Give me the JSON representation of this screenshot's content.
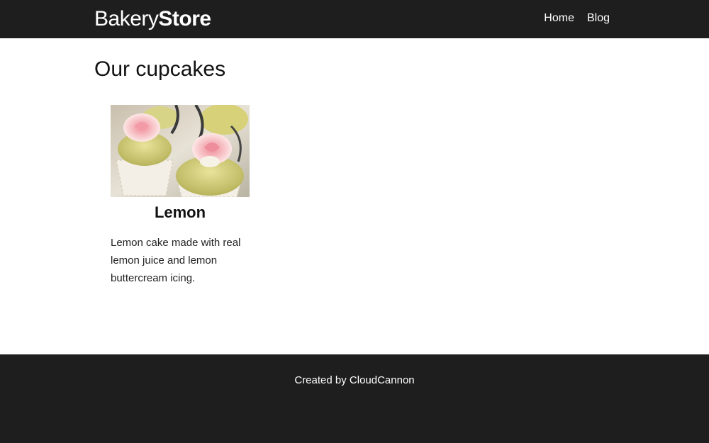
{
  "header": {
    "brand_part1": "Bakery",
    "brand_part2": "Store",
    "nav": [
      {
        "label": "Home"
      },
      {
        "label": "Blog"
      }
    ]
  },
  "main": {
    "title": "Our cupcakes",
    "products": [
      {
        "name": "Lemon",
        "description": "Lemon cake made with real lemon juice and lemon buttercream icing.",
        "image_alt": "Lemon cupcakes with pink roses"
      }
    ]
  },
  "footer": {
    "text": "Created by CloudCannon"
  },
  "colors": {
    "header_bg": "#1e1e1e",
    "footer_bg": "#1e1e1e",
    "text": "#111111"
  }
}
